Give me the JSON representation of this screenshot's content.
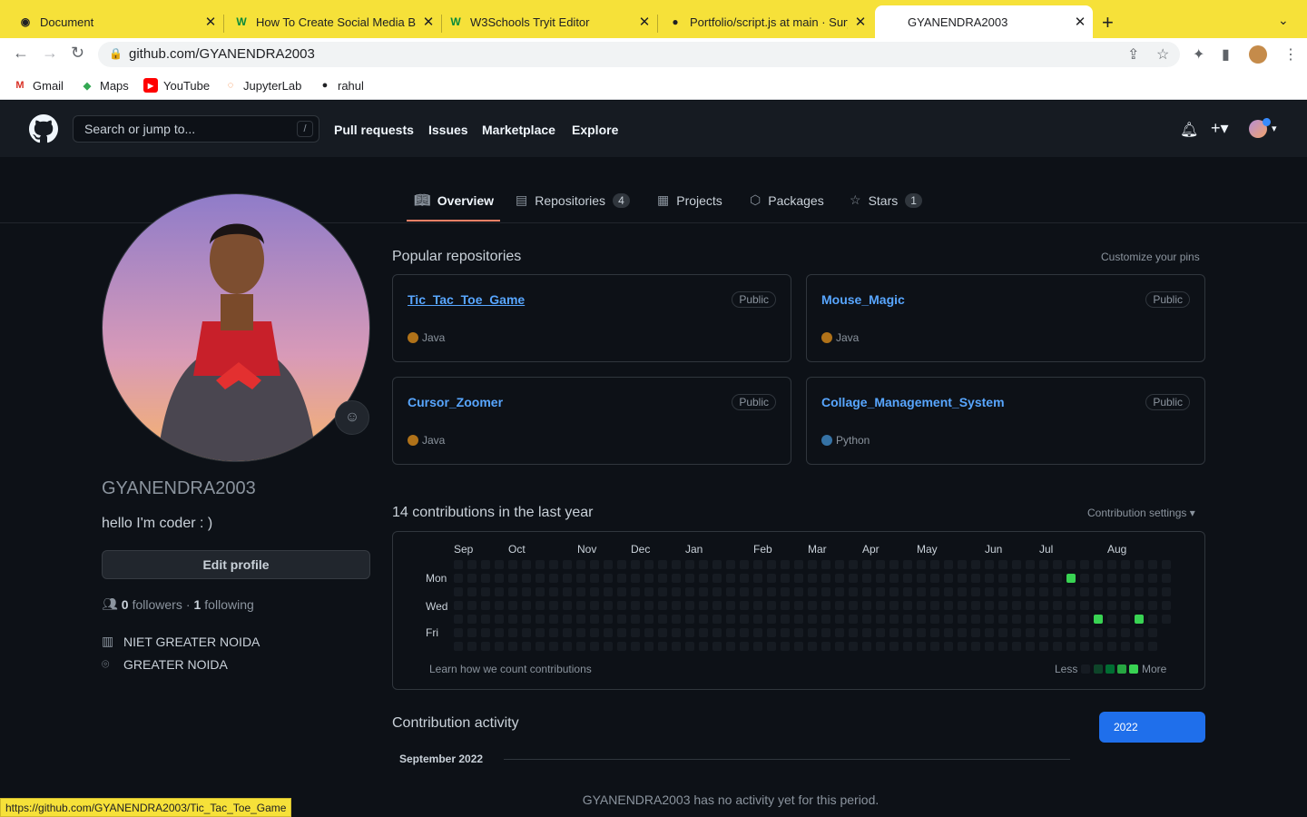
{
  "browser": {
    "tabs": [
      {
        "title": "Document",
        "icon": "globe-icon"
      },
      {
        "title": "How To Create Social Media Bu",
        "icon": "w-icon"
      },
      {
        "title": "W3Schools Tryit Editor",
        "icon": "w-icon"
      },
      {
        "title": "Portfolio/script.js at main · Sury",
        "icon": "github-icon"
      },
      {
        "title": "GYANENDRA2003",
        "icon": "github-icon",
        "active": true
      }
    ],
    "url": "github.com/GYANENDRA2003",
    "bookmarks": [
      "Gmail",
      "Maps",
      "YouTube",
      "JupyterLab",
      "rahul"
    ],
    "status_url": "https://github.com/GYANENDRA2003/Tic_Tac_Toe_Game",
    "accent": "#f6e139"
  },
  "github": {
    "search_placeholder": "Search or jump to...",
    "slash": "/",
    "nav": [
      "Pull requests",
      "Issues",
      "Marketplace",
      "Explore"
    ],
    "profile_tabs": [
      {
        "label": "Overview",
        "icon": "book-icon"
      },
      {
        "label": "Repositories",
        "icon": "repo-icon",
        "count": "4"
      },
      {
        "label": "Projects",
        "icon": "table-icon"
      },
      {
        "label": "Packages",
        "icon": "package-icon"
      },
      {
        "label": "Stars",
        "icon": "star-icon",
        "count": "1"
      }
    ]
  },
  "profile": {
    "username": "GYANENDRA2003",
    "bio": "hello I'm coder : )",
    "edit_label": "Edit profile",
    "followers": "0",
    "followers_label": "followers",
    "sep": "·",
    "following": "1",
    "following_label": "following",
    "org": "NIET GREATER NOIDA",
    "location": "GREATER NOIDA"
  },
  "popular": {
    "title": "Popular repositories",
    "customize": "Customize your pins",
    "repos": [
      {
        "name": "Tic_Tac_Toe_Game",
        "visibility": "Public",
        "language": "Java",
        "color": "#b07219"
      },
      {
        "name": "Mouse_Magic",
        "visibility": "Public",
        "language": "Java",
        "color": "#b07219"
      },
      {
        "name": "Cursor_Zoomer",
        "visibility": "Public",
        "language": "Java",
        "color": "#b07219"
      },
      {
        "name": "Collage_Management_System",
        "visibility": "Public",
        "language": "Python",
        "color": "#3572A5"
      }
    ]
  },
  "contributions": {
    "title": "14 contributions in the last year",
    "settings": "Contribution settings ▾",
    "months": [
      "Sep",
      "Oct",
      "Nov",
      "Dec",
      "Jan",
      "Feb",
      "Mar",
      "Apr",
      "May",
      "Jun",
      "Jul",
      "Aug"
    ],
    "days": [
      "Mon",
      "Wed",
      "Fri"
    ],
    "learn": "Learn how we count contributions",
    "less": "Less",
    "more": "More",
    "active_cells": [
      [
        45,
        1
      ],
      [
        47,
        4
      ],
      [
        50,
        4
      ]
    ]
  },
  "activity": {
    "title": "Contribution activity",
    "year": "2022",
    "month": "September 2022",
    "empty": "GYANENDRA2003 has no activity yet for this period."
  }
}
